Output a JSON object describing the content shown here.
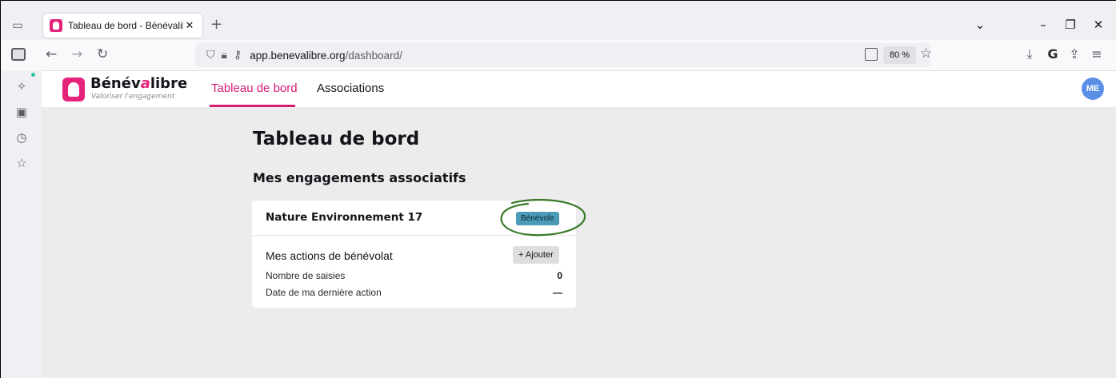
{
  "browser": {
    "tab": {
      "title": "Tableau de bord - Bénévalibre",
      "close": "✕"
    },
    "new_tab": "+",
    "window_controls": {
      "list_all_tabs": "⌄",
      "minimize": "–",
      "restore": "❐",
      "close": "✕"
    },
    "nav": {
      "back": "←",
      "forward": "→",
      "reload": "↻"
    },
    "url": {
      "host": "app.benevalibre.org",
      "path": "/dashboard/"
    },
    "zoom": "80 %",
    "icons": [
      "tab-list-icon",
      "sidebar-icon",
      "shield-icon",
      "lock-icon",
      "key-icon",
      "reader-view-icon",
      "bookmark-star-icon",
      "download-icon",
      "extension-icon",
      "share-icon",
      "menu-icon"
    ],
    "sidebar_icons": [
      "ai-sparkle-icon",
      "synced-tabs-icon",
      "history-icon",
      "bookmarks-icon"
    ]
  },
  "app": {
    "brand": {
      "name_prefix": "Bénév",
      "name_italic": "a",
      "name_suffix": "libre",
      "tagline": "Valoriser l'engagement",
      "color": "#e6237a"
    },
    "nav": [
      {
        "label": "Tableau de bord",
        "active": true
      },
      {
        "label": "Associations",
        "active": false
      }
    ],
    "user_initials": "ME"
  },
  "main": {
    "title": "Tableau de bord",
    "section_title": "Mes engagements associatifs",
    "card": {
      "association": "Nature Environnement 17",
      "role": "Bénévole",
      "role_color": "#4a9ab8",
      "subtitle": "Mes actions de bénévolat",
      "add_button": "+ Ajouter",
      "rows": [
        {
          "label": "Nombre de saisies",
          "value": "0"
        },
        {
          "label": "Date de ma dernière action",
          "value": "—"
        }
      ]
    },
    "annotation_color": "#3a7a2a"
  }
}
